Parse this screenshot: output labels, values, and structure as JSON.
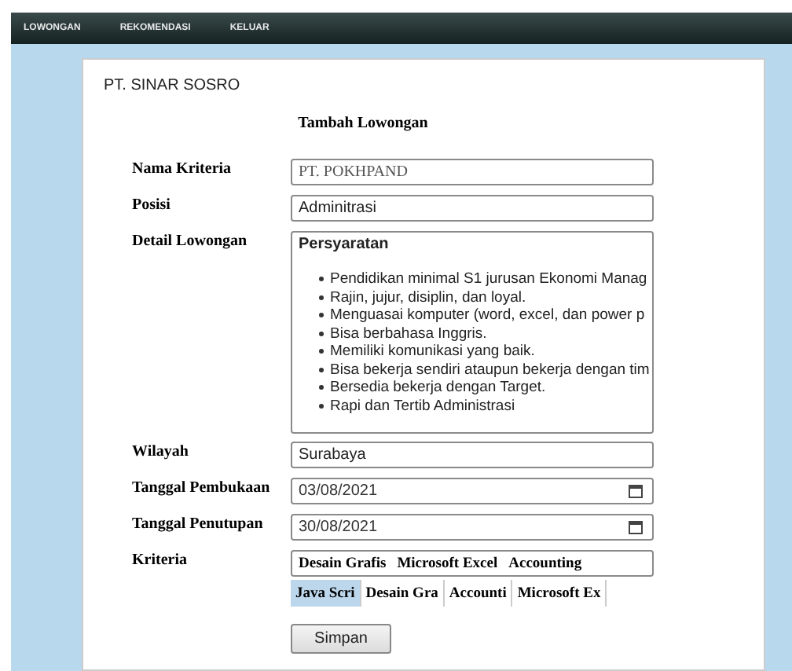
{
  "nav": [
    {
      "label": "LOWONGAN"
    },
    {
      "label": "REKOMENDASI"
    },
    {
      "label": "KELUAR"
    }
  ],
  "company": "PT. SINAR SOSRO",
  "form_title": "Tambah Lowongan",
  "fields": [
    {
      "kind": "text",
      "label": "Nama Kriteria",
      "value": "PT. POKHPAND"
    },
    {
      "kind": "text",
      "label": "Posisi",
      "value": "Adminitrasi"
    },
    {
      "kind": "textarea",
      "label": "Detail Lowongan",
      "heading": "Persyaratan",
      "items": [
        "Pendidikan minimal S1 jurusan Ekonomi Manag",
        "Rajin, jujur, disiplin, dan loyal.",
        "Menguasai komputer (word, excel, dan power p",
        "Bisa berbahasa Inggris.",
        "Memiliki komunikasi yang baik.",
        "Bisa bekerja sendiri ataupun bekerja dengan tim",
        "Bersedia bekerja dengan Target.",
        "Rapi dan Tertib Administrasi"
      ]
    },
    {
      "kind": "text",
      "label": "Wilayah",
      "value": "Surabaya"
    },
    {
      "kind": "date",
      "label": "Tanggal Pembukaan",
      "value": "03/08/2021"
    },
    {
      "kind": "date",
      "label": "Tanggal Penutupan",
      "value": "30/08/2021"
    },
    {
      "kind": "tags",
      "label": "Kriteria",
      "tags": [
        "Desain Grafis",
        "Microsoft Excel",
        "Accounting"
      ],
      "options": [
        {
          "label": "Java Scri",
          "selected": true
        },
        {
          "label": "Desain Gra",
          "selected": false
        },
        {
          "label": "Accounti",
          "selected": false
        },
        {
          "label": "Microsoft Ex",
          "selected": false
        }
      ]
    }
  ],
  "submit": "Simpan"
}
